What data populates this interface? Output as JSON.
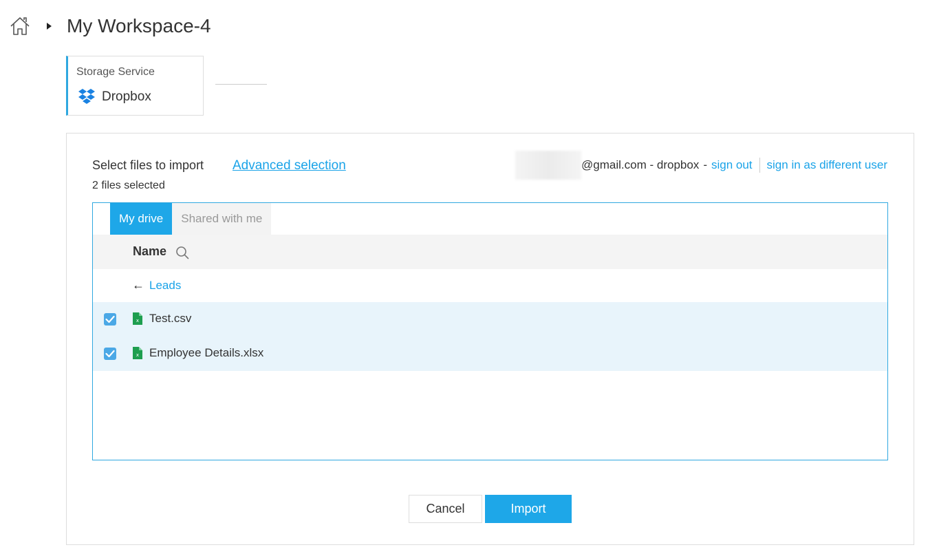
{
  "header": {
    "title": "My Workspace-4"
  },
  "storage": {
    "label": "Storage Service",
    "service": "Dropbox"
  },
  "panel": {
    "select_label": "Select files to import",
    "advanced_link": "Advanced selection",
    "files_selected": "2 files selected",
    "account": {
      "email_suffix": "@gmail.com - dropbox",
      "separator": "-",
      "sign_out": "sign out",
      "sign_in_different": "sign in as different user"
    }
  },
  "browser": {
    "tabs": [
      {
        "label": "My drive",
        "active": true
      },
      {
        "label": "Shared with me",
        "active": false
      }
    ],
    "column_name": "Name",
    "back_arrow": "←",
    "back_folder": "Leads",
    "files": [
      {
        "name": "Test.csv",
        "checked": true
      },
      {
        "name": "Employee Details.xlsx",
        "checked": true
      }
    ]
  },
  "buttons": {
    "cancel": "Cancel",
    "import": "Import"
  },
  "colors": {
    "accent": "#1ea7e8",
    "link": "#1aa3e8",
    "row_selected": "#e8f4fb",
    "file_icon": "#1e9e4f"
  },
  "icons": {
    "home": "home-icon",
    "breadcrumb": "caret-right-icon",
    "storage": "dropbox-icon",
    "search": "search-icon",
    "file": "spreadsheet-file-icon",
    "checkbox": "checkmark-icon"
  }
}
